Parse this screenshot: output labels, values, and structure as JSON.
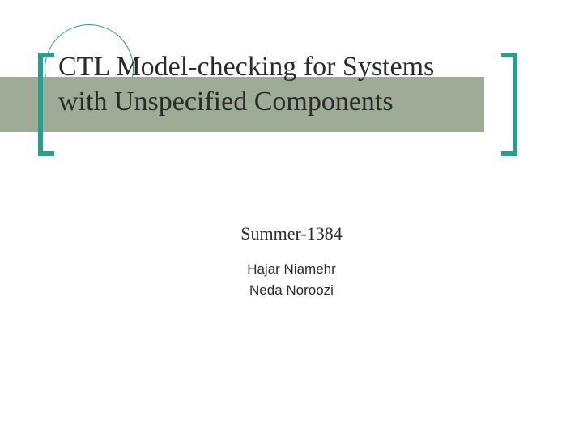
{
  "title": "CTL Model-checking for Systems with Unspecified Components",
  "subtitle": "Summer-1384",
  "authors": {
    "author1": "Hajar Niamehr",
    "author2": "Neda Noroozi"
  }
}
